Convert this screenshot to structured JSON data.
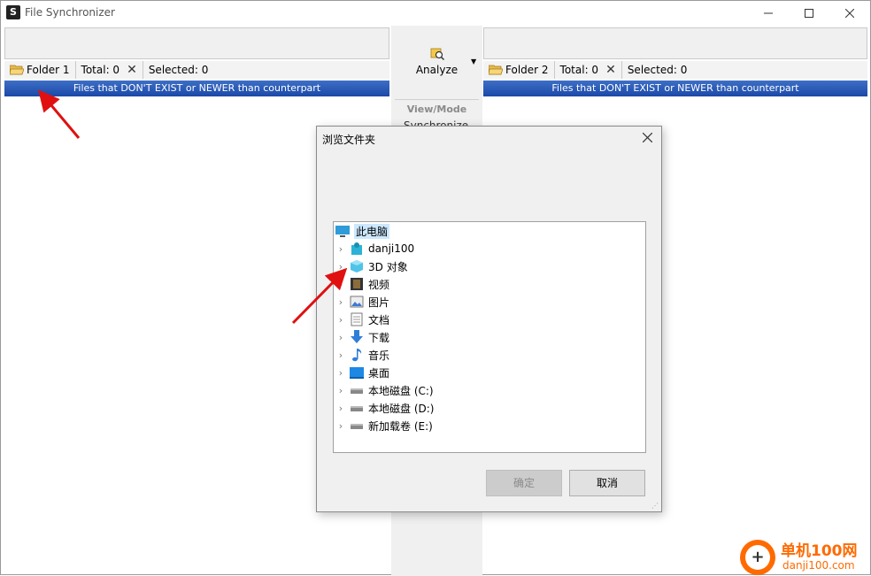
{
  "window": {
    "title": "File Synchronizer"
  },
  "left_panel": {
    "folder_label": "Folder 1",
    "total": "Total: 0",
    "selected": "Selected: 0",
    "header": "Files that DON'T EXIST or NEWER than counterpart"
  },
  "right_panel": {
    "folder_label": "Folder 2",
    "total": "Total: 0",
    "selected": "Selected: 0",
    "header": "Files that DON'T EXIST or NEWER than counterpart"
  },
  "center": {
    "analyze_label": "Analyze",
    "view_mode": "View/Mode",
    "sync_partial": "Synchronize"
  },
  "dialog": {
    "title": "浏览文件夹",
    "tree": [
      {
        "label": "此电脑",
        "icon": "computer-icon"
      },
      {
        "label": "danji100",
        "icon": "user-folder-icon"
      },
      {
        "label": "3D 对象",
        "icon": "3d-objects-icon"
      },
      {
        "label": "视频",
        "icon": "video-icon"
      },
      {
        "label": "图片",
        "icon": "pictures-icon"
      },
      {
        "label": "文档",
        "icon": "documents-icon"
      },
      {
        "label": "下载",
        "icon": "download-icon"
      },
      {
        "label": "音乐",
        "icon": "music-icon"
      },
      {
        "label": "桌面",
        "icon": "desktop-icon"
      },
      {
        "label": "本地磁盘 (C:)",
        "icon": "drive-icon"
      },
      {
        "label": "本地磁盘 (D:)",
        "icon": "drive-icon"
      },
      {
        "label": "新加载卷 (E:)",
        "icon": "drive-icon"
      }
    ],
    "ok_label": "确定",
    "cancel_label": "取消"
  },
  "watermark": {
    "brand": "单机100网",
    "url": "danji100.com"
  },
  "colors": {
    "header_blue": "#1a49a8",
    "arrow_red": "#e01010",
    "selection": "#cce8ff"
  }
}
